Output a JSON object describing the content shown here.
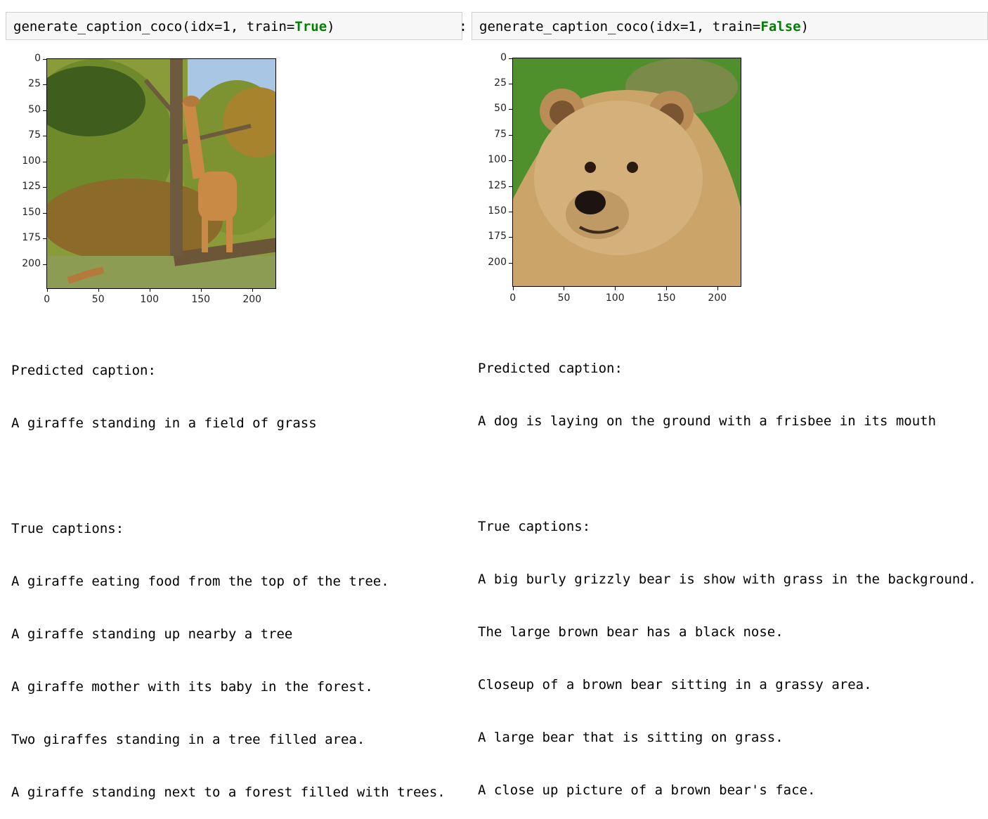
{
  "left": {
    "code_fn": "generate_caption_coco(idx=1, train=",
    "code_kw": "True",
    "code_end": ")",
    "y_ticks": [
      "0",
      "25",
      "50",
      "75",
      "100",
      "125",
      "150",
      "175",
      "200"
    ],
    "x_ticks": [
      "0",
      "50",
      "100",
      "150",
      "200"
    ],
    "predicted_header": "Predicted caption:",
    "predicted": "A giraffe standing in a field of grass",
    "true_header": "True captions:",
    "true_captions": [
      "A giraffe eating food from the top of the tree.",
      "A giraffe standing up nearby a tree",
      "A giraffe mother with its baby in the forest.",
      "Two giraffes standing in a tree filled area.",
      "A giraffe standing next to a forest filled with trees."
    ]
  },
  "right": {
    "prompt_colon": ":",
    "code_fn": "generate_caption_coco(idx=1, train=",
    "code_kw": "False",
    "code_end": ")",
    "y_ticks": [
      "0",
      "25",
      "50",
      "75",
      "100",
      "125",
      "150",
      "175",
      "200"
    ],
    "x_ticks": [
      "0",
      "50",
      "100",
      "150",
      "200"
    ],
    "predicted_header": "Predicted caption:",
    "predicted": "A dog is laying on the ground with a frisbee in its mouth",
    "true_header": "True captions:",
    "true_captions": [
      "A big burly grizzly bear is show with grass in the background.",
      "The large brown bear has a black nose.",
      "Closeup of a brown bear sitting in a grassy area.",
      "A large bear that is sitting on grass.",
      "A close up picture of a brown bear's face."
    ]
  },
  "colors": {
    "keyword": "#008000",
    "cell_bg": "#f7f7f7",
    "cell_border": "#cfcfcf"
  }
}
